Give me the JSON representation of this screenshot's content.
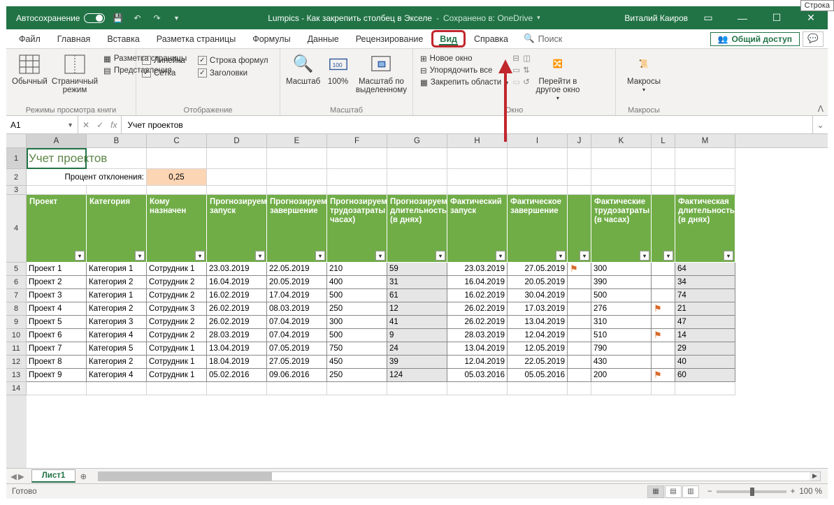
{
  "titlebar": {
    "autosave": "Автосохранение",
    "doc": "Lumpics - Как закрепить столбец в Экселе",
    "saved": "Сохранено в: OneDrive",
    "user": "Виталий Каиров"
  },
  "tabs": {
    "file": "Файл",
    "home": "Главная",
    "insert": "Вставка",
    "layout": "Разметка страницы",
    "formulas": "Формулы",
    "data": "Данные",
    "review": "Рецензирование",
    "view": "Вид",
    "help": "Справка",
    "search": "Поиск",
    "share": "Общий доступ"
  },
  "ribbon": {
    "normal": "Обычный",
    "page_break": "Страничный режим",
    "page_layout": "Разметка страницы",
    "custom_views": "Представления",
    "group_views": "Режимы просмотра книги",
    "ruler": "Линейка",
    "gridlines": "Сетка",
    "formula_bar": "Строка формул",
    "headings": "Заголовки",
    "group_show": "Отображение",
    "zoom": "Масштаб",
    "hundred": "100%",
    "zoom_sel": "Масштаб по выделенному",
    "group_zoom": "Масштаб",
    "new_window": "Новое окно",
    "arrange": "Упорядочить все",
    "freeze": "Закрепить области",
    "switch": "Перейти в другое окно",
    "group_window": "Окно",
    "macros": "Макросы",
    "group_macros": "Макросы"
  },
  "namebox": "A1",
  "formula": "Учет проектов",
  "cols": [
    "A",
    "B",
    "C",
    "D",
    "E",
    "F",
    "G",
    "H",
    "I",
    "J",
    "K",
    "L",
    "M"
  ],
  "title_cell": "Учет проектов",
  "deviation_label": "Процент отклонения:",
  "deviation_value": "0,25",
  "headers": {
    "project": "Проект",
    "category": "Категория",
    "assigned": "Кому назначен",
    "pstart": "Прогнозируемый запуск",
    "pend": "Прогнозируемое завершение",
    "phours": "Прогнозируемые трудозатраты (в часах)",
    "pdays": "Прогнозируемая длительность (в днях)",
    "astart": "Фактический запуск",
    "aend": "Фактическое завершение",
    "ahours": "Фактические трудозатраты (в часах)",
    "adays": "Фактическая длительность (в днях)"
  },
  "rows": [
    {
      "n": 5,
      "p": "Проект 1",
      "c": "Категория 1",
      "a": "Сотрудник 1",
      "ps": "23.03.2019",
      "pe": "22.05.2019",
      "ph": "210",
      "pd": "59",
      "as": "23.03.2019",
      "ae": "27.05.2019",
      "fj": "⚑",
      "ah": "300",
      "fl": "",
      "ad": "64"
    },
    {
      "n": 6,
      "p": "Проект 2",
      "c": "Категория 2",
      "a": "Сотрудник 2",
      "ps": "16.04.2019",
      "pe": "20.05.2019",
      "ph": "400",
      "pd": "31",
      "as": "16.04.2019",
      "ae": "20.05.2019",
      "fj": "",
      "ah": "390",
      "fl": "",
      "ad": "34"
    },
    {
      "n": 7,
      "p": "Проект 3",
      "c": "Категория 1",
      "a": "Сотрудник 2",
      "ps": "16.02.2019",
      "pe": "17.04.2019",
      "ph": "500",
      "pd": "61",
      "as": "16.02.2019",
      "ae": "30.04.2019",
      "fj": "",
      "ah": "500",
      "fl": "",
      "ad": "74"
    },
    {
      "n": 8,
      "p": "Проект 4",
      "c": "Категория 2",
      "a": "Сотрудник 3",
      "ps": "26.02.2019",
      "pe": "08.03.2019",
      "ph": "250",
      "pd": "12",
      "as": "26.02.2019",
      "ae": "17.03.2019",
      "fj": "",
      "ah": "276",
      "fl": "⚑",
      "ad": "21"
    },
    {
      "n": 9,
      "p": "Проект 5",
      "c": "Категория 3",
      "a": "Сотрудник 2",
      "ps": "26.02.2019",
      "pe": "07.04.2019",
      "ph": "300",
      "pd": "41",
      "as": "26.02.2019",
      "ae": "13.04.2019",
      "fj": "",
      "ah": "310",
      "fl": "",
      "ad": "47"
    },
    {
      "n": 10,
      "p": "Проект 6",
      "c": "Категория 4",
      "a": "Сотрудник 2",
      "ps": "28.03.2019",
      "pe": "07.04.2019",
      "ph": "500",
      "pd": "9",
      "as": "28.03.2019",
      "ae": "12.04.2019",
      "fj": "",
      "ah": "510",
      "fl": "⚑",
      "ad": "14"
    },
    {
      "n": 11,
      "p": "Проект 7",
      "c": "Категория 5",
      "a": "Сотрудник 1",
      "ps": "13.04.2019",
      "pe": "07.05.2019",
      "ph": "750",
      "pd": "24",
      "as": "13.04.2019",
      "ae": "12.05.2019",
      "fj": "",
      "ah": "790",
      "fl": "",
      "ad": "29"
    },
    {
      "n": 12,
      "p": "Проект 8",
      "c": "Категория 2",
      "a": "Сотрудник 1",
      "ps": "18.04.2019",
      "pe": "27.05.2019",
      "ph": "450",
      "pd": "39",
      "as": "12.04.2019",
      "ae": "22.05.2019",
      "fj": "",
      "ah": "430",
      "fl": "",
      "ad": "40"
    },
    {
      "n": 13,
      "p": "Проект 9",
      "c": "Категория 4",
      "a": "Сотрудник 1",
      "ps": "05.02.2016",
      "pe": "09.06.2016",
      "ph": "250",
      "pd": "124",
      "as": "05.03.2016",
      "ae": "05.05.2016",
      "fj": "",
      "ah": "200",
      "fl": "⚑",
      "ad": "60"
    }
  ],
  "sheet": "Лист1",
  "status": "Готово",
  "zoom_pct": "100 %",
  "tooltip": "Строка"
}
